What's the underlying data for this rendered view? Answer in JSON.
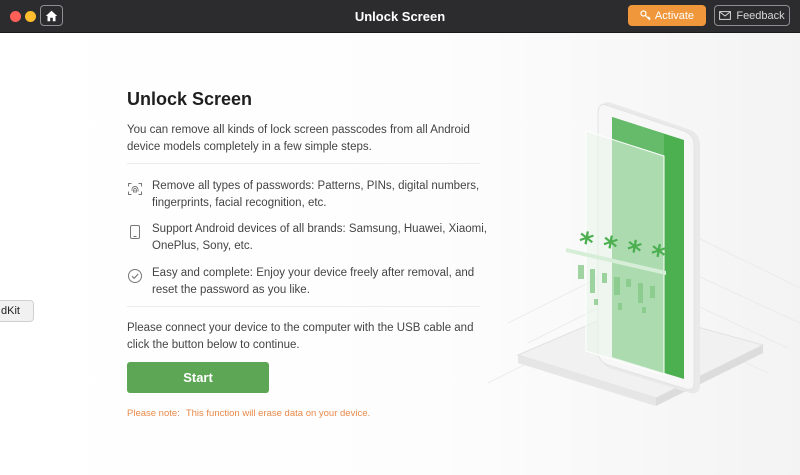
{
  "window": {
    "title": "Unlock Screen",
    "activate_label": "Activate",
    "feedback_label": "Feedback"
  },
  "main": {
    "heading": "Unlock Screen",
    "intro": "You can remove all kinds of lock screen passcodes from all Android device models completely in a few simple steps.",
    "features": [
      {
        "icon": "fingerprint-icon",
        "text": "Remove all types of passwords: Patterns, PINs, digital numbers, fingerprints, facial recognition, etc."
      },
      {
        "icon": "phone-icon",
        "text": "Support Android devices of all brands: Samsung, Huawei, Xiaomi, OnePlus, Sony, etc."
      },
      {
        "icon": "check-circle-icon",
        "text": "Easy and complete: Enjoy your device freely after removal, and reset the password as you like."
      }
    ],
    "connect_text": "Please connect your device to the computer with the USB cable and click the button below to continue.",
    "start_label": "Start",
    "note_label": "Please note:",
    "note_text": "This function will erase data on your device."
  },
  "illustration": {
    "password_mask": "* * * *"
  },
  "background_window": {
    "tab_label": "dKit"
  },
  "colors": {
    "accent_green": "#5da656",
    "activate_orange": "#f0973c",
    "note_orange": "#e98a4a",
    "titlebar": "#2c2c2e"
  }
}
